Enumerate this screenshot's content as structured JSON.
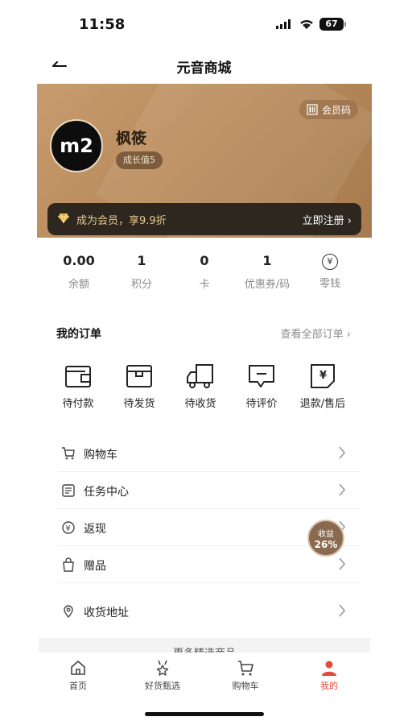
{
  "status_bar": {
    "time": "11:58",
    "battery": "67"
  },
  "nav": {
    "title": "元音商城"
  },
  "member_card": {
    "code_label": "会员码",
    "avatar_text": "m2",
    "name": "枫筱",
    "growth": "成长值5",
    "promo_text": "成为会员，享9.9折",
    "register_label": "立即注册",
    "accent_color": "#e7c88d"
  },
  "stats": [
    {
      "value": "0.00",
      "label": "余额"
    },
    {
      "value": "1",
      "label": "积分"
    },
    {
      "value": "0",
      "label": "卡"
    },
    {
      "value": "1",
      "label": "优惠券/码"
    },
    {
      "value": "",
      "label": "零钱"
    }
  ],
  "orders": {
    "title": "我的订单",
    "view_all": "查看全部订单",
    "items": [
      {
        "label": "待付款",
        "icon": "wallet-icon"
      },
      {
        "label": "待发货",
        "icon": "box-icon"
      },
      {
        "label": "待收货",
        "icon": "truck-icon"
      },
      {
        "label": "待评价",
        "icon": "comment-icon"
      },
      {
        "label": "退款/售后",
        "icon": "refund-icon"
      }
    ]
  },
  "menu": [
    {
      "label": "购物车",
      "icon": "cart-icon"
    },
    {
      "label": "任务中心",
      "icon": "task-icon"
    },
    {
      "label": "返现",
      "icon": "cashback-icon"
    },
    {
      "label": "赠品",
      "icon": "gift-icon"
    },
    {
      "label": "收货地址",
      "icon": "location-icon"
    }
  ],
  "earnings_badge": {
    "label": "收益",
    "value": "26%"
  },
  "more_section": {
    "title": "更多精选商品"
  },
  "tabbar": [
    {
      "label": "首页",
      "icon": "home-icon",
      "active": false
    },
    {
      "label": "好货甄选",
      "icon": "badge-icon",
      "active": false
    },
    {
      "label": "购物车",
      "icon": "cart-icon",
      "active": false
    },
    {
      "label": "我的",
      "icon": "person-icon",
      "active": true
    }
  ],
  "colors": {
    "active_tab": "#e24b3b",
    "card_gradient_start": "#c79c6e",
    "card_gradient_end": "#a57a4e"
  }
}
